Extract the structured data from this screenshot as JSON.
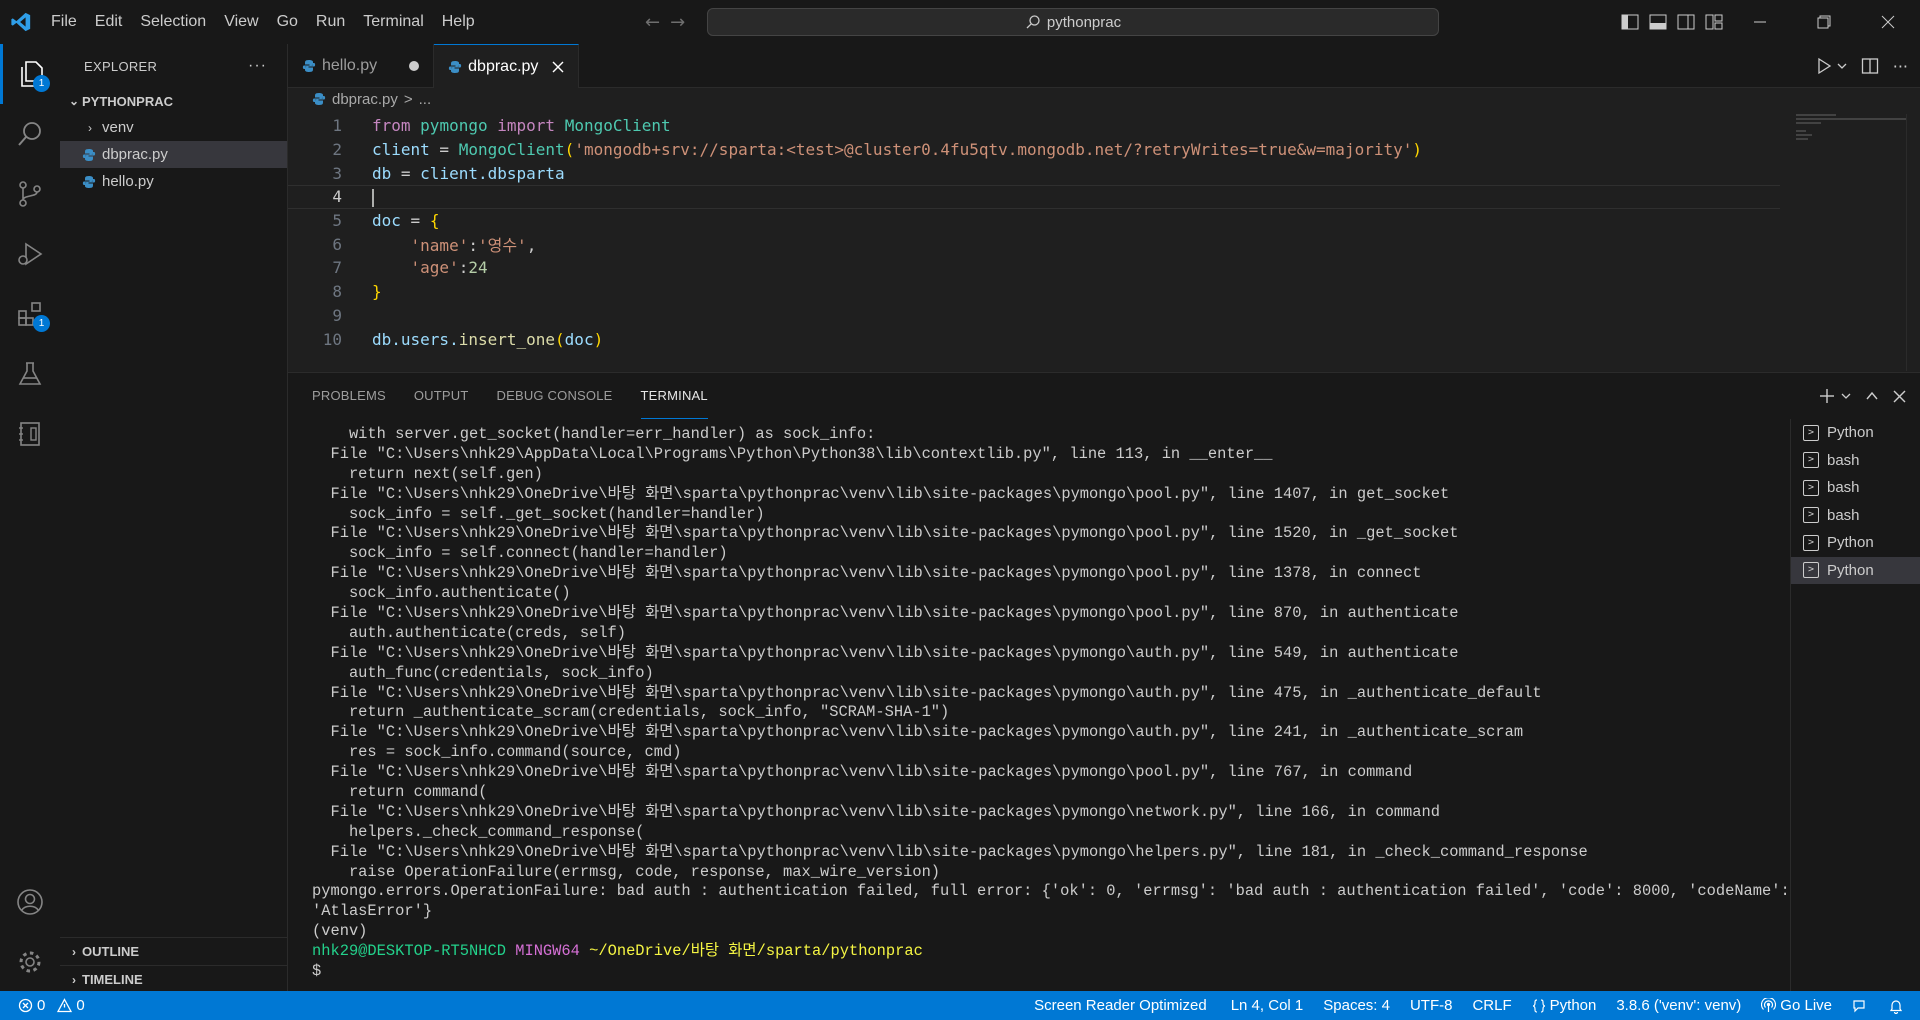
{
  "titlebar": {
    "menu": [
      "File",
      "Edit",
      "Selection",
      "View",
      "Go",
      "Run",
      "Terminal",
      "Help"
    ],
    "search_text": "pythonprac"
  },
  "activity_bar": {
    "explorer_badge": "1",
    "extensions_badge": "1"
  },
  "sidebar": {
    "title": "EXPLORER",
    "more": "···",
    "root": "PYTHONPRAC",
    "items": [
      {
        "label": "venv",
        "type": "folder"
      },
      {
        "label": "dbprac.py",
        "type": "file"
      },
      {
        "label": "hello.py",
        "type": "file"
      }
    ],
    "outline": "OUTLINE",
    "timeline": "TIMELINE"
  },
  "editor": {
    "tabs": [
      {
        "label": "hello.py"
      },
      {
        "label": "dbprac.py"
      }
    ],
    "breadcrumb_file": "dbprac.py",
    "breadcrumb_sep": ">",
    "breadcrumb_more": "...",
    "line_numbers": [
      "1",
      "2",
      "3",
      "4",
      "5",
      "6",
      "7",
      "8",
      "9",
      "10"
    ],
    "code": {
      "l1_from": "from",
      "l1_mod": "pymongo",
      "l1_import": "import",
      "l1_cls": "MongoClient",
      "l2_var": "client",
      "l2_eq": " = ",
      "l2_cls": "MongoClient",
      "l2_str": "'mongodb+srv://sparta:<test>@cluster0.4fu5qtv.mongodb.net/?retryWrites=true&w=majority'",
      "l3_var": "db",
      "l3_eq": " = ",
      "l3_obj": "client",
      "l3_attr": ".dbsparta",
      "l5_var": "doc",
      "l5_eq": " = ",
      "l6_key": "'name'",
      "l6_val": "'영수'",
      "l7_key": "'age'",
      "l7_val": "24",
      "l10_obj": "db",
      "l10_attr": ".users.",
      "l10_fn": "insert_one",
      "l10_arg": "doc"
    }
  },
  "panel": {
    "tabs": [
      "PROBLEMS",
      "OUTPUT",
      "DEBUG CONSOLE",
      "TERMINAL"
    ],
    "terminal_lines": [
      "    with server.get_socket(handler=err_handler) as sock_info:",
      "  File \"C:\\Users\\nhk29\\AppData\\Local\\Programs\\Python\\Python38\\lib\\contextlib.py\", line 113, in __enter__",
      "    return next(self.gen)",
      "  File \"C:\\Users\\nhk29\\OneDrive\\바탕 화면\\sparta\\pythonprac\\venv\\lib\\site-packages\\pymongo\\pool.py\", line 1407, in get_socket",
      "    sock_info = self._get_socket(handler=handler)",
      "  File \"C:\\Users\\nhk29\\OneDrive\\바탕 화면\\sparta\\pythonprac\\venv\\lib\\site-packages\\pymongo\\pool.py\", line 1520, in _get_socket",
      "    sock_info = self.connect(handler=handler)",
      "  File \"C:\\Users\\nhk29\\OneDrive\\바탕 화면\\sparta\\pythonprac\\venv\\lib\\site-packages\\pymongo\\pool.py\", line 1378, in connect",
      "    sock_info.authenticate()",
      "  File \"C:\\Users\\nhk29\\OneDrive\\바탕 화면\\sparta\\pythonprac\\venv\\lib\\site-packages\\pymongo\\pool.py\", line 870, in authenticate",
      "    auth.authenticate(creds, self)",
      "  File \"C:\\Users\\nhk29\\OneDrive\\바탕 화면\\sparta\\pythonprac\\venv\\lib\\site-packages\\pymongo\\auth.py\", line 549, in authenticate",
      "    auth_func(credentials, sock_info)",
      "  File \"C:\\Users\\nhk29\\OneDrive\\바탕 화면\\sparta\\pythonprac\\venv\\lib\\site-packages\\pymongo\\auth.py\", line 475, in _authenticate_default",
      "    return _authenticate_scram(credentials, sock_info, \"SCRAM-SHA-1\")",
      "  File \"C:\\Users\\nhk29\\OneDrive\\바탕 화면\\sparta\\pythonprac\\venv\\lib\\site-packages\\pymongo\\auth.py\", line 241, in _authenticate_scram",
      "    res = sock_info.command(source, cmd)",
      "  File \"C:\\Users\\nhk29\\OneDrive\\바탕 화면\\sparta\\pythonprac\\venv\\lib\\site-packages\\pymongo\\pool.py\", line 767, in command",
      "    return command(",
      "  File \"C:\\Users\\nhk29\\OneDrive\\바탕 화면\\sparta\\pythonprac\\venv\\lib\\site-packages\\pymongo\\network.py\", line 166, in command",
      "    helpers._check_command_response(",
      "  File \"C:\\Users\\nhk29\\OneDrive\\바탕 화면\\sparta\\pythonprac\\venv\\lib\\site-packages\\pymongo\\helpers.py\", line 181, in _check_command_response",
      "    raise OperationFailure(errmsg, code, response, max_wire_version)",
      "pymongo.errors.OperationFailure: bad auth : authentication failed, full error: {'ok': 0, 'errmsg': 'bad auth : authentication failed', 'code': 8000, 'codeName':",
      "'AtlasError'}",
      "(venv)"
    ],
    "prompt_user": "nhk29@DESKTOP-RT5NHCD",
    "prompt_env": "MINGW64",
    "prompt_path": "~/OneDrive/바탕 화면/sparta/pythonprac",
    "prompt_symbol": "$",
    "terminal_list": [
      "Python",
      "bash",
      "bash",
      "bash",
      "Python",
      "Python"
    ]
  },
  "statusbar": {
    "errors": "0",
    "warnings": "0",
    "screen_reader": "Screen Reader Optimized",
    "position": "Ln 4, Col 1",
    "spaces": "Spaces: 4",
    "encoding": "UTF-8",
    "eol": "CRLF",
    "language": "Python",
    "interpreter": "3.8.6 ('venv': venv)",
    "live": "Go Live"
  },
  "colors": {
    "accent": "#0078d4",
    "keyword": "#c586c0",
    "class": "#4ec9b0",
    "string": "#ce9178",
    "function": "#dcdcaa"
  }
}
